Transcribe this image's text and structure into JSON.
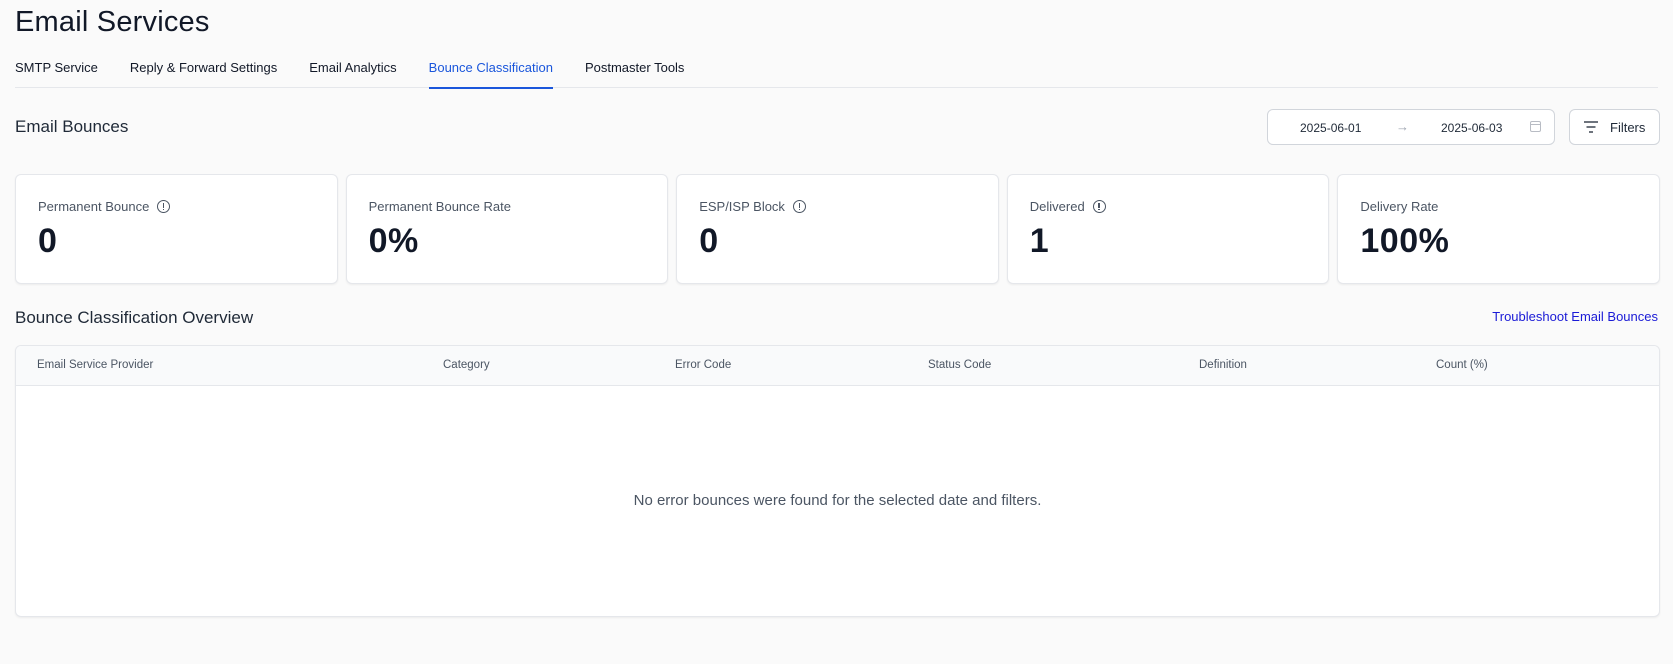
{
  "page": {
    "title": "Email Services"
  },
  "tabs": [
    {
      "label": "SMTP Service",
      "active": false
    },
    {
      "label": "Reply & Forward Settings",
      "active": false
    },
    {
      "label": "Email Analytics",
      "active": false
    },
    {
      "label": "Bounce Classification",
      "active": true
    },
    {
      "label": "Postmaster Tools",
      "active": false
    }
  ],
  "bounces": {
    "title": "Email Bounces",
    "date_from": "2025-06-01",
    "date_arrow": "→",
    "date_to": "2025-06-03",
    "filters_label": "Filters"
  },
  "cards": [
    {
      "label": "Permanent Bounce",
      "value": "0",
      "icon": "info-icon"
    },
    {
      "label": "Permanent Bounce Rate",
      "value": "0%",
      "icon": ""
    },
    {
      "label": "ESP/ISP Block",
      "value": "0",
      "icon": "info-icon"
    },
    {
      "label": "Delivered",
      "value": "1",
      "icon": "info-icon"
    },
    {
      "label": "Delivery Rate",
      "value": "100%",
      "icon": ""
    }
  ],
  "overview": {
    "title": "Bounce Classification Overview",
    "link": "Troubleshoot Email Bounces",
    "columns": [
      "Email Service Provider",
      "Category",
      "Error Code",
      "Status Code",
      "Definition",
      "Count (%)"
    ],
    "empty_message": "No error bounces were found for the selected date and filters."
  },
  "colors": {
    "accent": "#1a56db",
    "link": "#1a1ad6"
  }
}
